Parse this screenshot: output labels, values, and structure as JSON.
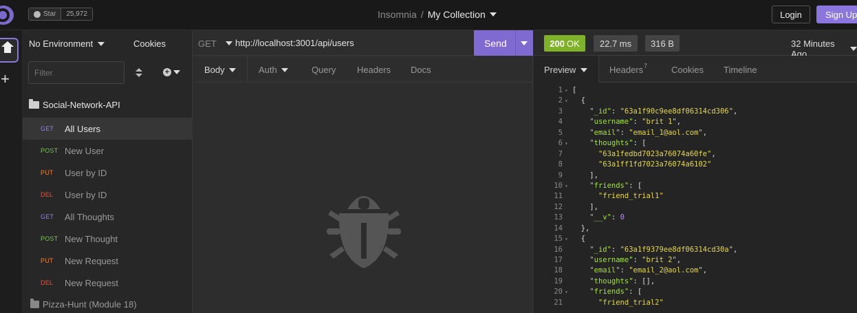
{
  "topbar": {
    "star_label": "Star",
    "star_count": "25,972",
    "app_name": "Insomnia",
    "separator": "/",
    "collection_name": "My Collection",
    "login_label": "Login",
    "signup_label": "Sign Up"
  },
  "sidebar": {
    "environment": "No Environment",
    "cookies": "Cookies",
    "filter_placeholder": "Filter",
    "workspace": "Social-Network-API",
    "requests": [
      {
        "method": "GET",
        "name": "All Users",
        "color": "#8f82e8",
        "active": true
      },
      {
        "method": "POST",
        "name": "New User",
        "color": "#79c94a"
      },
      {
        "method": "PUT",
        "name": "User by ID",
        "color": "#e8863a"
      },
      {
        "method": "DEL",
        "name": "User by ID",
        "color": "#e25a4a"
      },
      {
        "method": "GET",
        "name": "All Thoughts",
        "color": "#8f82e8"
      },
      {
        "method": "POST",
        "name": "New Thought",
        "color": "#79c94a"
      },
      {
        "method": "PUT",
        "name": "New Request",
        "color": "#e8863a"
      },
      {
        "method": "DEL",
        "name": "New Request",
        "color": "#e25a4a"
      }
    ],
    "folder": "Pizza-Hunt (Module 18)"
  },
  "request": {
    "method": "GET",
    "url": "http://localhost:3001/api/users",
    "send_label": "Send",
    "tabs": [
      "Body",
      "Auth",
      "Query",
      "Headers",
      "Docs"
    ]
  },
  "response": {
    "status_code": "200",
    "status_text": "OK",
    "time": "22.7 ms",
    "size": "316 B",
    "ago": "32 Minutes Ago",
    "tabs": {
      "preview": "Preview",
      "headers": "Headers",
      "headers_count": "7",
      "cookies": "Cookies",
      "timeline": "Timeline"
    },
    "lines": [
      {
        "n": "1",
        "fold": true,
        "text": "["
      },
      {
        "n": "2",
        "fold": true,
        "text": "  {"
      },
      {
        "n": "3",
        "key": "_id",
        "val": "\"63a1f90c9ee8df06314cd306\"",
        "type": "s",
        "indent": 4,
        "comma": true
      },
      {
        "n": "4",
        "key": "username",
        "val": "\"brit 1\"",
        "type": "s",
        "indent": 4,
        "comma": true
      },
      {
        "n": "5",
        "key": "email",
        "val": "\"email_1@aol.com\"",
        "type": "s",
        "indent": 4,
        "comma": true
      },
      {
        "n": "6",
        "fold": true,
        "key": "thoughts",
        "val": "[",
        "type": "p",
        "indent": 4
      },
      {
        "n": "7",
        "raw": "\"63a1fedbd7023a76074a60fe\"",
        "type": "s",
        "indent": 6,
        "comma": true
      },
      {
        "n": "8",
        "raw": "\"63a1ff1fd7023a76074a6102\"",
        "type": "s",
        "indent": 6
      },
      {
        "n": "9",
        "text": "    ],"
      },
      {
        "n": "10",
        "fold": true,
        "key": "friends",
        "val": "[",
        "type": "p",
        "indent": 4
      },
      {
        "n": "11",
        "raw": "\"friend_trial1\"",
        "type": "s",
        "indent": 6
      },
      {
        "n": "12",
        "text": "    ],"
      },
      {
        "n": "13",
        "key": "__v",
        "val": "0",
        "type": "n",
        "indent": 4
      },
      {
        "n": "14",
        "text": "  },"
      },
      {
        "n": "15",
        "fold": true,
        "text": "  {"
      },
      {
        "n": "16",
        "key": "_id",
        "val": "\"63a1f9379ee8df06314cd30a\"",
        "type": "s",
        "indent": 4,
        "comma": true
      },
      {
        "n": "17",
        "key": "username",
        "val": "\"brit 2\"",
        "type": "s",
        "indent": 4,
        "comma": true
      },
      {
        "n": "18",
        "key": "email",
        "val": "\"email_2@aol.com\"",
        "type": "s",
        "indent": 4,
        "comma": true
      },
      {
        "n": "19",
        "key": "thoughts",
        "val": "[]",
        "type": "p",
        "indent": 4,
        "comma": true
      },
      {
        "n": "20",
        "fold": true,
        "key": "friends",
        "val": "[",
        "type": "p",
        "indent": 4
      },
      {
        "n": "21",
        "raw": "\"friend_trial2\"",
        "type": "s",
        "indent": 6
      }
    ]
  }
}
